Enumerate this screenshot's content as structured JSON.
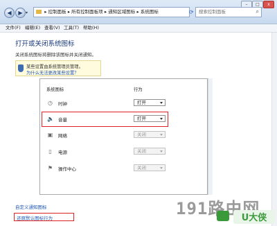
{
  "window": {
    "breadcrumb": [
      "控制面板",
      "所有控制面板项",
      "通知区域图标",
      "系统图标"
    ],
    "search_placeholder": "搜索控制面板",
    "controls": {
      "minimize": "–",
      "maximize": "□",
      "close": "x"
    }
  },
  "menu": {
    "items": [
      "文件(F)",
      "编辑(E)",
      "查看(V)",
      "工具(T)",
      "帮助(H)"
    ]
  },
  "page": {
    "title": "打开或关闭系统图标",
    "description": "关闭系统图标将删除该图标并关闭通知。",
    "notice_line1": "某些设置由系统管理员管理。",
    "notice_line2": "为什么无法更改某些设置？"
  },
  "table": {
    "col_icon": "系统图标",
    "col_behavior": "行为",
    "rows": [
      {
        "label": "时钟",
        "icon": "clock-icon",
        "value": "打开",
        "enabled": true
      },
      {
        "label": "音量",
        "icon": "volume-icon",
        "value": "打开",
        "enabled": true
      },
      {
        "label": "网络",
        "icon": "network-icon",
        "value": "关闭",
        "enabled": false
      },
      {
        "label": "电源",
        "icon": "power-icon",
        "value": "关闭",
        "enabled": false
      },
      {
        "label": "操作中心",
        "icon": "action-center-icon",
        "value": "关闭",
        "enabled": false
      }
    ]
  },
  "links": {
    "customize": "自定义通知图标",
    "restore": "还原默认图标行为"
  },
  "watermark": {
    "text": "191路由网",
    "logo": "U大侠"
  },
  "colors": {
    "highlight": "#dd2222",
    "link": "#1f57b8",
    "heading": "#1a3a7a"
  }
}
